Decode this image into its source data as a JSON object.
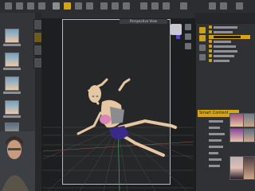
{
  "app": {
    "viewport_label": "Perspective View",
    "scene_title": "Scene",
    "selected_node": "Base Female Feminine",
    "scene_items": [
      "Environment Options",
      "Default Lights",
      "Base Female Feminine",
      "Hair",
      "Bikini Top",
      "Bikini Bottom",
      "Default Camera",
      "Render Settings"
    ],
    "lower_panel_header": "Smart Content"
  },
  "colors": {
    "accent": "#d6a515",
    "viewport_bg": "#1d1e20",
    "panel_bg": "#333538",
    "gizmo": "#5a3fd4"
  },
  "icons": [
    "menu-icon",
    "gear-icon",
    "camera-icon",
    "eye-icon",
    "folder-icon",
    "scroll-arrow-icon"
  ]
}
